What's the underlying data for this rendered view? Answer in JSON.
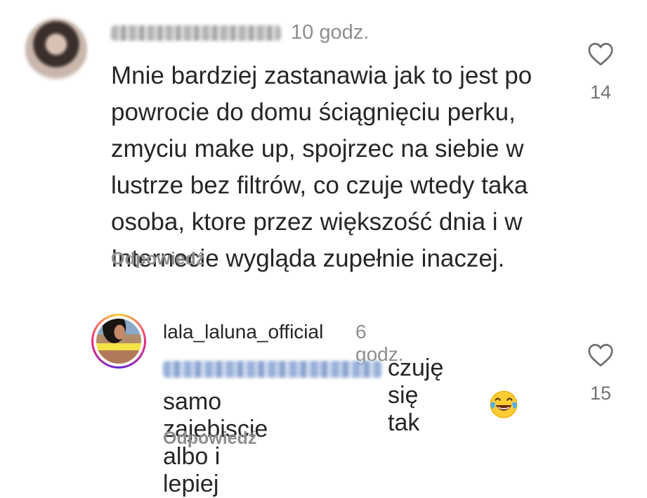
{
  "comments": [
    {
      "time": "10 godz.",
      "text": "Mnie bardziej zastanawia jak to jest po powrocie do domu ściągnięciu perku, zmyciu make up, spojrzec na siebie w lustrze bez filtrów, co czuje wtedy taka osoba, ktore przez większość dnia i w Internecie wygląda zupełnie inaczej.",
      "reply_label": "Odpowiedź",
      "likes": "14"
    }
  ],
  "reply": {
    "username": "lala_laluna_official",
    "time": "6 godz.",
    "text_line1": "czuję się tak",
    "text_line2": "samo zajebiscie albo i lepiej",
    "reply_label": "Odpowiedź",
    "likes": "15"
  },
  "icons": {
    "like": "heart-icon",
    "emoji": "face-with-tears-of-joy"
  },
  "colors": {
    "text": "#262626",
    "muted": "#8e8e8e",
    "story_ring": [
      "#f9ce34",
      "#ee2a7b",
      "#6228d7"
    ]
  }
}
